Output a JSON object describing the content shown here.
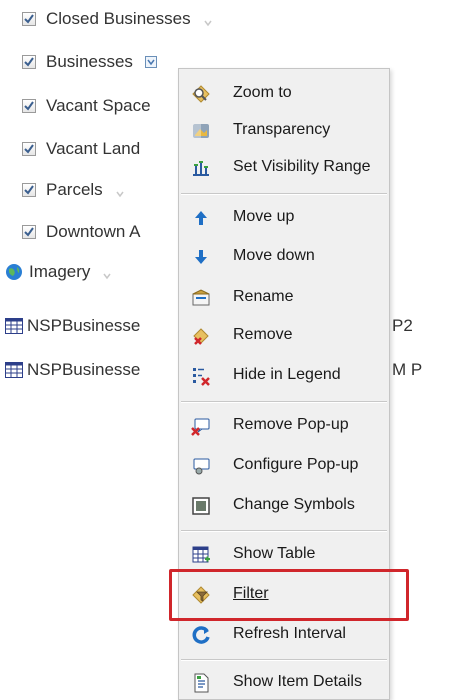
{
  "layers": [
    {
      "label": "Closed Businesses",
      "checked": true
    },
    {
      "label": "Businesses",
      "checked": true
    },
    {
      "label": "Vacant Space",
      "checked": true
    },
    {
      "label": "Vacant Land",
      "checked": true
    },
    {
      "label": "Parcels",
      "checked": true
    },
    {
      "label": "Downtown A",
      "checked": true
    }
  ],
  "basemap": {
    "label": "Imagery",
    "icon": "globe-icon"
  },
  "tables": [
    {
      "label": "NSPBusinesse",
      "tail": "P2",
      "icon": "table-icon"
    },
    {
      "label": "NSPBusinesse",
      "tail": "M P",
      "icon": "table-icon"
    }
  ],
  "context_menu": {
    "groups": [
      [
        {
          "label": "Zoom to",
          "icon": "zoom-to-icon"
        },
        {
          "label": "Transparency",
          "icon": "transparency-icon"
        },
        {
          "label": "Set Visibility Range",
          "icon": "visibility-range-icon"
        }
      ],
      [
        {
          "label": "Move up",
          "icon": "arrow-up-icon"
        },
        {
          "label": "Move down",
          "icon": "arrow-down-icon"
        },
        {
          "label": "Rename",
          "icon": "rename-icon"
        },
        {
          "label": "Remove",
          "icon": "remove-icon"
        },
        {
          "label": "Hide in Legend",
          "icon": "hide-legend-icon"
        }
      ],
      [
        {
          "label": "Remove Pop-up",
          "icon": "remove-popup-icon"
        },
        {
          "label": "Configure Pop-up",
          "icon": "configure-popup-icon"
        },
        {
          "label": "Change Symbols",
          "icon": "change-symbols-icon"
        }
      ],
      [
        {
          "label": "Show Table",
          "icon": "show-table-icon"
        },
        {
          "label": "Filter",
          "icon": "filter-icon"
        },
        {
          "label": "Refresh Interval",
          "icon": "refresh-icon"
        }
      ],
      [
        {
          "label": "Show Item Details",
          "icon": "item-details-icon"
        }
      ]
    ]
  },
  "highlighted_item": "Filter",
  "colors": {
    "highlight_border": "#d0262b",
    "menu_background": "#f0f0f0",
    "arrow_blue": "#1f6fc5"
  }
}
